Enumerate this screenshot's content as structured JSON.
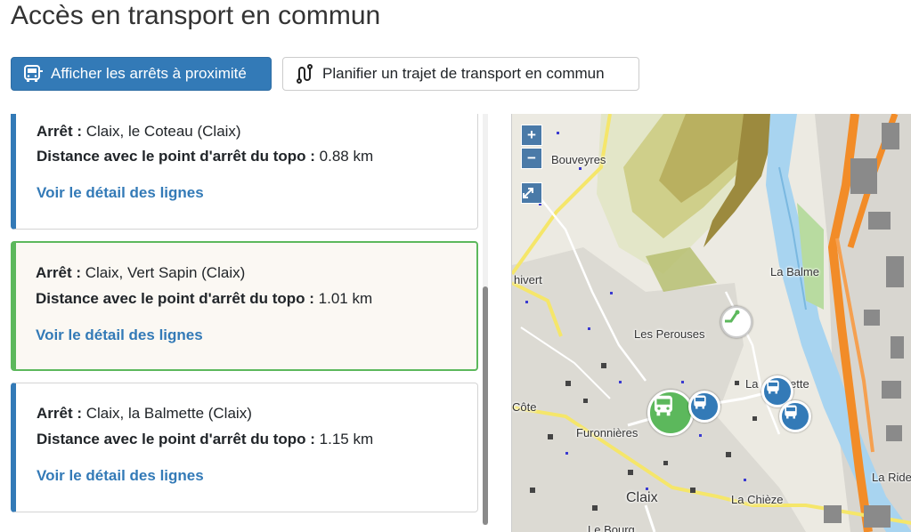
{
  "page": {
    "title": "Accès en transport en commun"
  },
  "toolbar": {
    "nearby_label": "Afficher les arrêts à proximité",
    "plan_label": "Planifier un trajet de transport en commun"
  },
  "stops": [
    {
      "label": "Arrêt :",
      "name": "Claix, le Coteau (Claix)",
      "distance_label": "Distance avec le point d'arrêt du topo :",
      "distance": "0.88 km",
      "link": "Voir le détail des lignes"
    },
    {
      "label": "Arrêt :",
      "name": "Claix, Vert Sapin (Claix)",
      "distance_label": "Distance avec le point d'arrêt du topo :",
      "distance": "1.01 km",
      "link": "Voir le détail des lignes"
    },
    {
      "label": "Arrêt :",
      "name": "Claix, la Balmette (Claix)",
      "distance_label": "Distance avec le point d'arrêt du topo :",
      "distance": "1.15 km",
      "link": "Voir le détail des lignes"
    }
  ],
  "map": {
    "zoom_in": "+",
    "zoom_out": "−",
    "labels": {
      "bouveyres": "Bouveyres",
      "la_balme": "La Balme",
      "chivert": "hivert",
      "les_perouses": "Les Perouses",
      "la_balmette": "La",
      "la_balmette_2": "ette",
      "cote": "Côte",
      "furonnieres": "Furonnières",
      "claix": "Claix",
      "la_chieze": "La Chièze",
      "le_bourg": "Le Bourg",
      "la_ride": "La Ride"
    },
    "colors": {
      "selected_marker": "#5cb85c",
      "stop_marker": "#337ab7",
      "highway": "#f28c28",
      "river": "#a8d4f0"
    }
  },
  "colors": {
    "primary": "#337ab7",
    "active": "#5cb85c"
  }
}
